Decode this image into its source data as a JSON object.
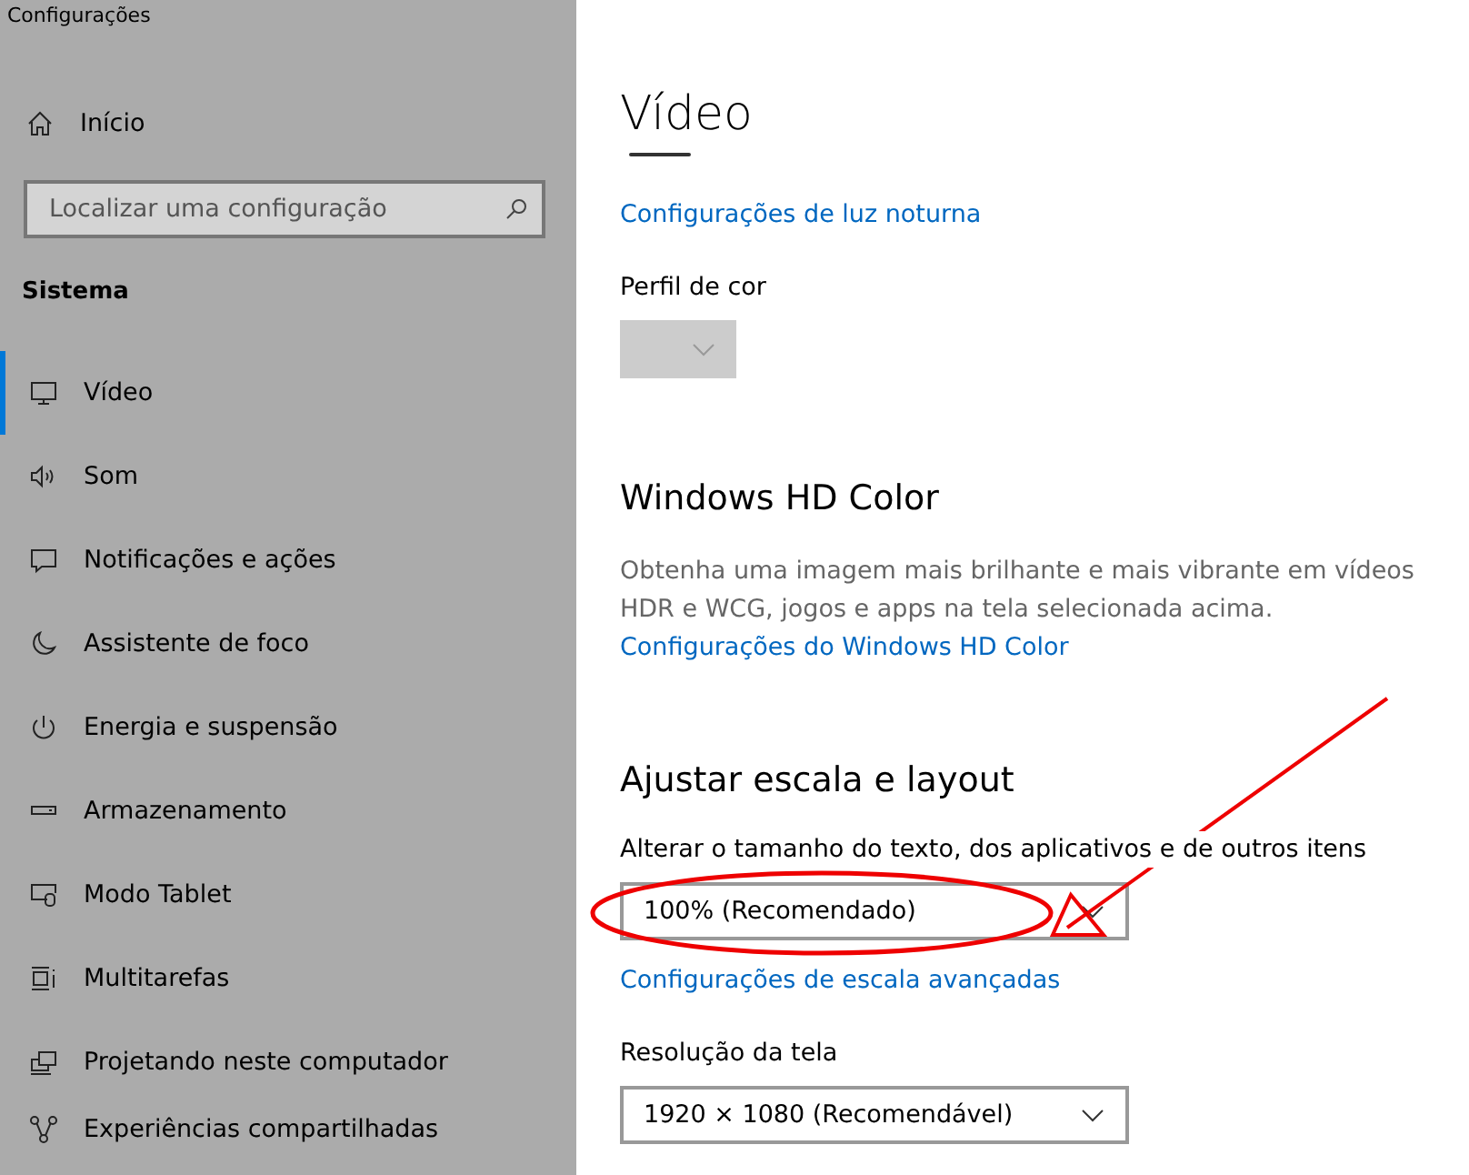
{
  "window": {
    "title": "Configurações"
  },
  "sidebar": {
    "home": "Início",
    "search": {
      "placeholder": "Localizar uma configuração"
    },
    "section": "Sistema",
    "items": [
      {
        "label": "Vídeo",
        "selected": true
      },
      {
        "label": "Som",
        "selected": false
      },
      {
        "label": "Notificações e ações",
        "selected": false
      },
      {
        "label": "Assistente de foco",
        "selected": false
      },
      {
        "label": "Energia e suspensão",
        "selected": false
      },
      {
        "label": "Armazenamento",
        "selected": false
      },
      {
        "label": "Modo Tablet",
        "selected": false
      },
      {
        "label": "Multitarefas",
        "selected": false
      },
      {
        "label": "Projetando neste computador",
        "selected": false
      },
      {
        "label": "Experiências compartilhadas",
        "selected": false
      }
    ]
  },
  "content": {
    "title": "Vídeo",
    "night_light_link": "Configurações de luz noturna",
    "color_profile": {
      "label": "Perfil de cor",
      "disabled": true
    },
    "hd_color": {
      "heading": "Windows HD Color",
      "description": "Obtenha uma imagem mais brilhante e mais vibrante em vídeos HDR e WCG, jogos e apps na tela selecionada acima.",
      "link": "Configurações do Windows HD Color"
    },
    "scale": {
      "heading": "Ajustar escala e layout",
      "label": "Alterar o tamanho do texto, dos aplicativos e de outros itens",
      "value": "100% (Recomendado)",
      "link": "Configurações de escala avançadas"
    },
    "resolution": {
      "label": "Resolução da tela",
      "value": "1920 × 1080 (Recomendável)"
    }
  }
}
